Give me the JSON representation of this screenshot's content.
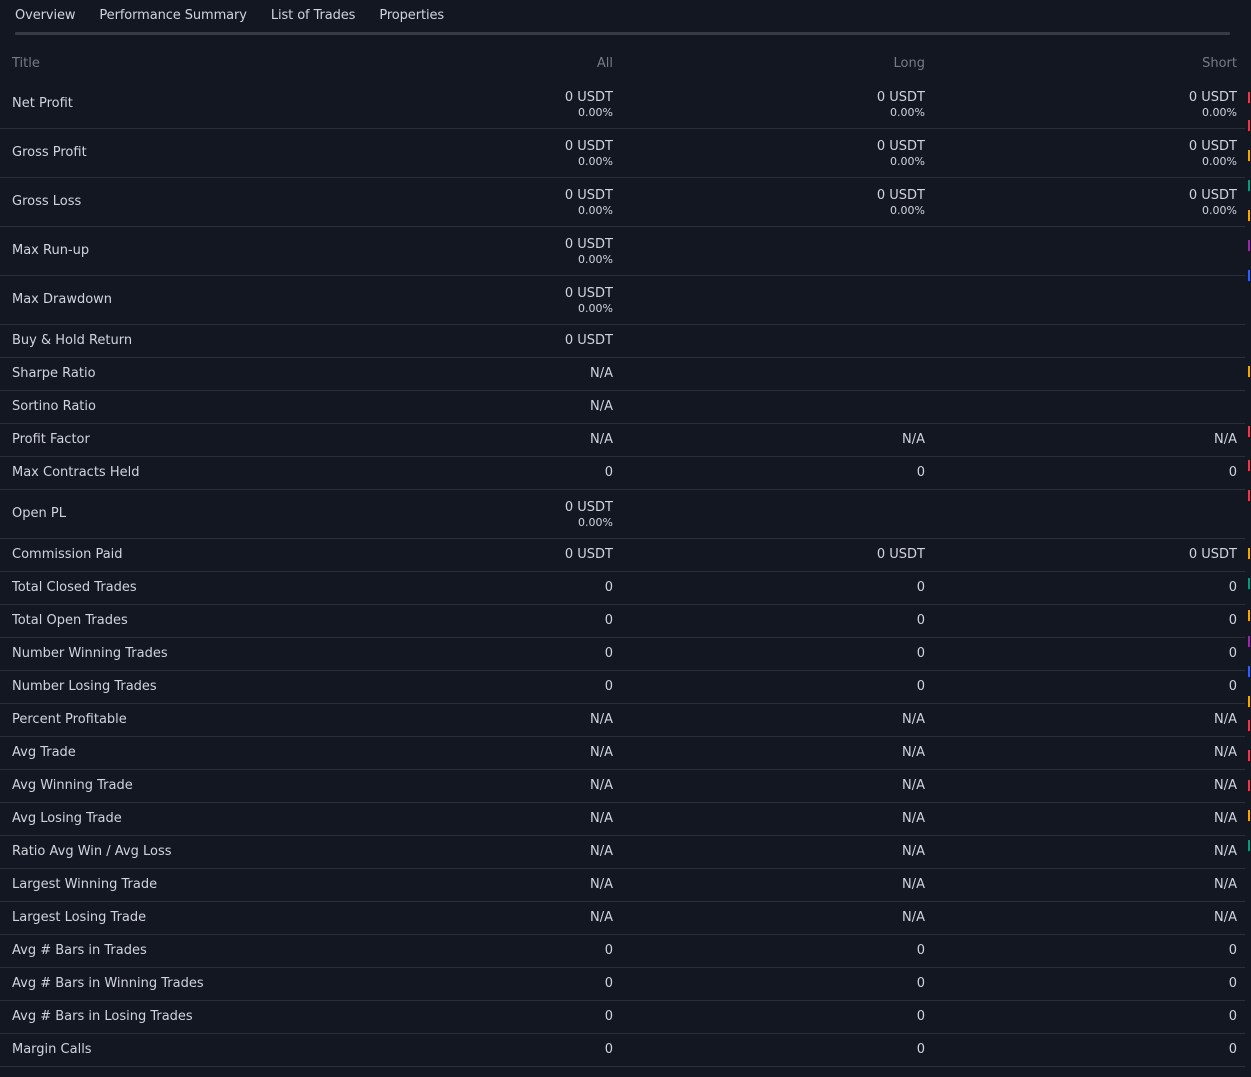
{
  "tabs": [
    {
      "label": "Overview",
      "active": false
    },
    {
      "label": "Performance Summary",
      "active": true
    },
    {
      "label": "List of Trades",
      "active": false
    },
    {
      "label": "Properties",
      "active": false
    }
  ],
  "table": {
    "headers": {
      "title": "Title",
      "all": "All",
      "long": "Long",
      "short": "Short"
    },
    "rows": [
      {
        "title": "Net Profit",
        "all": "0 USDT",
        "all_pct": "0.00%",
        "long": "0 USDT",
        "long_pct": "0.00%",
        "short": "0 USDT",
        "short_pct": "0.00%"
      },
      {
        "title": "Gross Profit",
        "all": "0 USDT",
        "all_pct": "0.00%",
        "long": "0 USDT",
        "long_pct": "0.00%",
        "short": "0 USDT",
        "short_pct": "0.00%"
      },
      {
        "title": "Gross Loss",
        "all": "0 USDT",
        "all_pct": "0.00%",
        "long": "0 USDT",
        "long_pct": "0.00%",
        "short": "0 USDT",
        "short_pct": "0.00%"
      },
      {
        "title": "Max Run-up",
        "all": "0 USDT",
        "all_pct": "0.00%",
        "long": "",
        "long_pct": "",
        "short": "",
        "short_pct": ""
      },
      {
        "title": "Max Drawdown",
        "all": "0 USDT",
        "all_pct": "0.00%",
        "long": "",
        "long_pct": "",
        "short": "",
        "short_pct": ""
      },
      {
        "title": "Buy & Hold Return",
        "all": "0 USDT",
        "all_pct": "",
        "long": "",
        "long_pct": "",
        "short": "",
        "short_pct": ""
      },
      {
        "title": "Sharpe Ratio",
        "all": "N/A",
        "all_pct": "",
        "long": "",
        "long_pct": "",
        "short": "",
        "short_pct": ""
      },
      {
        "title": "Sortino Ratio",
        "all": "N/A",
        "all_pct": "",
        "long": "",
        "long_pct": "",
        "short": "",
        "short_pct": ""
      },
      {
        "title": "Profit Factor",
        "all": "N/A",
        "all_pct": "",
        "long": "N/A",
        "long_pct": "",
        "short": "N/A",
        "short_pct": ""
      },
      {
        "title": "Max Contracts Held",
        "all": "0",
        "all_pct": "",
        "long": "0",
        "long_pct": "",
        "short": "0",
        "short_pct": ""
      },
      {
        "title": "Open PL",
        "all": "0 USDT",
        "all_pct": "0.00%",
        "long": "",
        "long_pct": "",
        "short": "",
        "short_pct": ""
      },
      {
        "title": "Commission Paid",
        "all": "0 USDT",
        "all_pct": "",
        "long": "0 USDT",
        "long_pct": "",
        "short": "0 USDT",
        "short_pct": ""
      },
      {
        "title": "Total Closed Trades",
        "all": "0",
        "all_pct": "",
        "long": "0",
        "long_pct": "",
        "short": "0",
        "short_pct": ""
      },
      {
        "title": "Total Open Trades",
        "all": "0",
        "all_pct": "",
        "long": "0",
        "long_pct": "",
        "short": "0",
        "short_pct": ""
      },
      {
        "title": "Number Winning Trades",
        "all": "0",
        "all_pct": "",
        "long": "0",
        "long_pct": "",
        "short": "0",
        "short_pct": ""
      },
      {
        "title": "Number Losing Trades",
        "all": "0",
        "all_pct": "",
        "long": "0",
        "long_pct": "",
        "short": "0",
        "short_pct": ""
      },
      {
        "title": "Percent Profitable",
        "all": "N/A",
        "all_pct": "",
        "long": "N/A",
        "long_pct": "",
        "short": "N/A",
        "short_pct": ""
      },
      {
        "title": "Avg Trade",
        "all": "N/A",
        "all_pct": "",
        "long": "N/A",
        "long_pct": "",
        "short": "N/A",
        "short_pct": ""
      },
      {
        "title": "Avg Winning Trade",
        "all": "N/A",
        "all_pct": "",
        "long": "N/A",
        "long_pct": "",
        "short": "N/A",
        "short_pct": ""
      },
      {
        "title": "Avg Losing Trade",
        "all": "N/A",
        "all_pct": "",
        "long": "N/A",
        "long_pct": "",
        "short": "N/A",
        "short_pct": ""
      },
      {
        "title": "Ratio Avg Win / Avg Loss",
        "all": "N/A",
        "all_pct": "",
        "long": "N/A",
        "long_pct": "",
        "short": "N/A",
        "short_pct": ""
      },
      {
        "title": "Largest Winning Trade",
        "all": "N/A",
        "all_pct": "",
        "long": "N/A",
        "long_pct": "",
        "short": "N/A",
        "short_pct": ""
      },
      {
        "title": "Largest Losing Trade",
        "all": "N/A",
        "all_pct": "",
        "long": "N/A",
        "long_pct": "",
        "short": "N/A",
        "short_pct": ""
      },
      {
        "title": "Avg # Bars in Trades",
        "all": "0",
        "all_pct": "",
        "long": "0",
        "long_pct": "",
        "short": "0",
        "short_pct": ""
      },
      {
        "title": "Avg # Bars in Winning Trades",
        "all": "0",
        "all_pct": "",
        "long": "0",
        "long_pct": "",
        "short": "0",
        "short_pct": ""
      },
      {
        "title": "Avg # Bars in Losing Trades",
        "all": "0",
        "all_pct": "",
        "long": "0",
        "long_pct": "",
        "short": "0",
        "short_pct": ""
      },
      {
        "title": "Margin Calls",
        "all": "0",
        "all_pct": "",
        "long": "0",
        "long_pct": "",
        "short": "0",
        "short_pct": ""
      }
    ]
  },
  "colors": {
    "background": "#131722",
    "text": "#d1d4dc",
    "muted": "#787b86",
    "divider": "#2a2e39",
    "tab_rail": "#363a45",
    "edge_marks": [
      "#f23645",
      "#f23645",
      "#f7a600",
      "#089981",
      "#f7a600",
      "#9c27b0",
      "#2962ff",
      "#f7a600",
      "#f23645"
    ]
  }
}
